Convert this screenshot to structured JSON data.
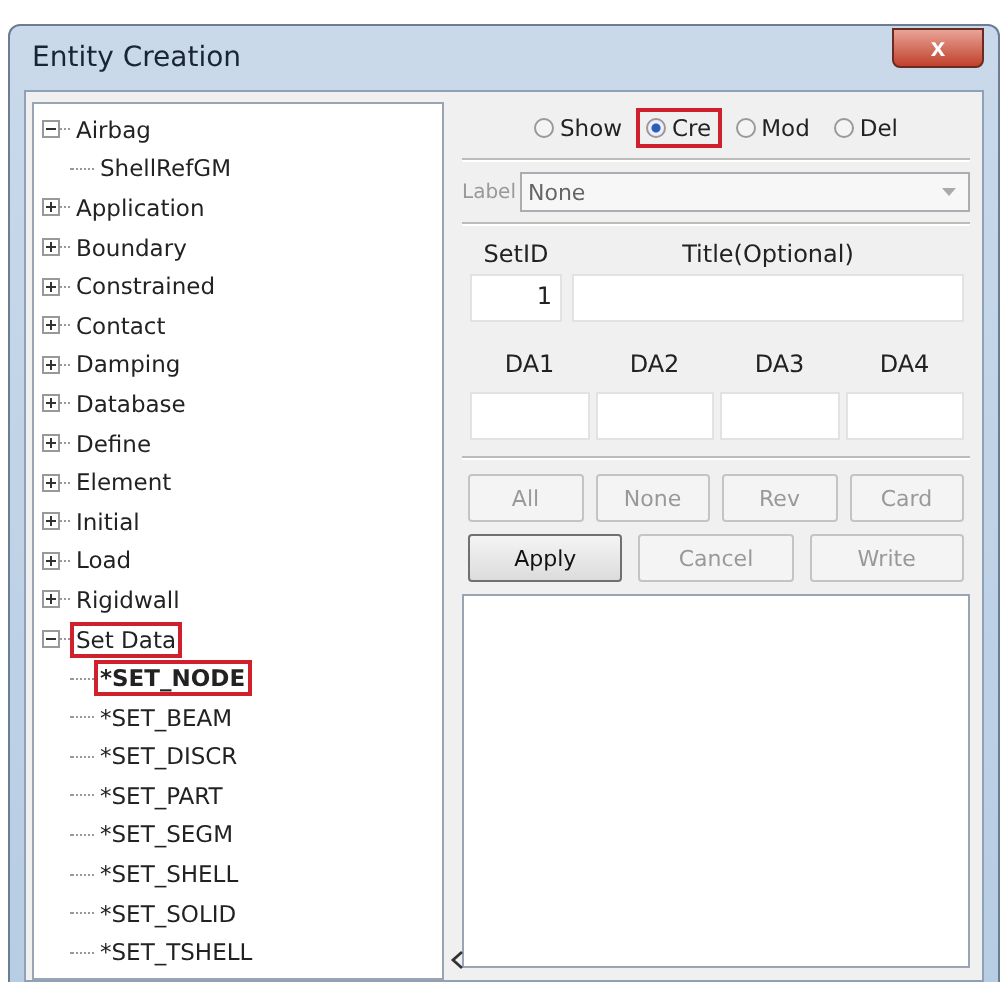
{
  "window": {
    "title": "Entity Creation",
    "close": "x"
  },
  "tree": [
    {
      "label": "Airbag",
      "expanded": true,
      "highlighted": false,
      "children": [
        {
          "label": "ShellRefGM",
          "bold": false,
          "highlighted": false
        }
      ]
    },
    {
      "label": "Application",
      "expanded": false,
      "highlighted": false
    },
    {
      "label": "Boundary",
      "expanded": false,
      "highlighted": false
    },
    {
      "label": "Constrained",
      "expanded": false,
      "highlighted": false
    },
    {
      "label": "Contact",
      "expanded": false,
      "highlighted": false
    },
    {
      "label": "Damping",
      "expanded": false,
      "highlighted": false
    },
    {
      "label": "Database",
      "expanded": false,
      "highlighted": false
    },
    {
      "label": "Define",
      "expanded": false,
      "highlighted": false
    },
    {
      "label": "Element",
      "expanded": false,
      "highlighted": false
    },
    {
      "label": "Initial",
      "expanded": false,
      "highlighted": false
    },
    {
      "label": "Load",
      "expanded": false,
      "highlighted": false
    },
    {
      "label": "Rigidwall",
      "expanded": false,
      "highlighted": false
    },
    {
      "label": "Set Data",
      "expanded": true,
      "highlighted": true,
      "children": [
        {
          "label": "*SET_NODE",
          "bold": true,
          "highlighted": true
        },
        {
          "label": "*SET_BEAM",
          "bold": false,
          "highlighted": false
        },
        {
          "label": "*SET_DISCR",
          "bold": false,
          "highlighted": false
        },
        {
          "label": "*SET_PART",
          "bold": false,
          "highlighted": false
        },
        {
          "label": "*SET_SEGM",
          "bold": false,
          "highlighted": false
        },
        {
          "label": "*SET_SHELL",
          "bold": false,
          "highlighted": false
        },
        {
          "label": "*SET_SOLID",
          "bold": false,
          "highlighted": false
        },
        {
          "label": "*SET_TSHELL",
          "bold": false,
          "highlighted": false
        }
      ]
    }
  ],
  "modes": [
    {
      "label": "Show",
      "selected": false,
      "highlighted": false
    },
    {
      "label": "Cre",
      "selected": true,
      "highlighted": true
    },
    {
      "label": "Mod",
      "selected": false,
      "highlighted": false
    },
    {
      "label": "Del",
      "selected": false,
      "highlighted": false
    }
  ],
  "label_select": {
    "label": "Label",
    "value": "None",
    "disabled": true
  },
  "setid": {
    "label": "SetID",
    "value": "1"
  },
  "title_field": {
    "label": "Title(Optional)"
  },
  "da_fields": [
    {
      "label": "DA1"
    },
    {
      "label": "DA2"
    },
    {
      "label": "DA3"
    },
    {
      "label": "DA4"
    }
  ],
  "select_buttons": [
    {
      "label": "All",
      "disabled": true
    },
    {
      "label": "None",
      "disabled": true
    },
    {
      "label": "Rev",
      "disabled": true
    },
    {
      "label": "Card",
      "disabled": true
    }
  ],
  "action_buttons": [
    {
      "label": "Apply",
      "disabled": false
    },
    {
      "label": "Cancel",
      "disabled": true
    },
    {
      "label": "Write",
      "disabled": true
    }
  ]
}
